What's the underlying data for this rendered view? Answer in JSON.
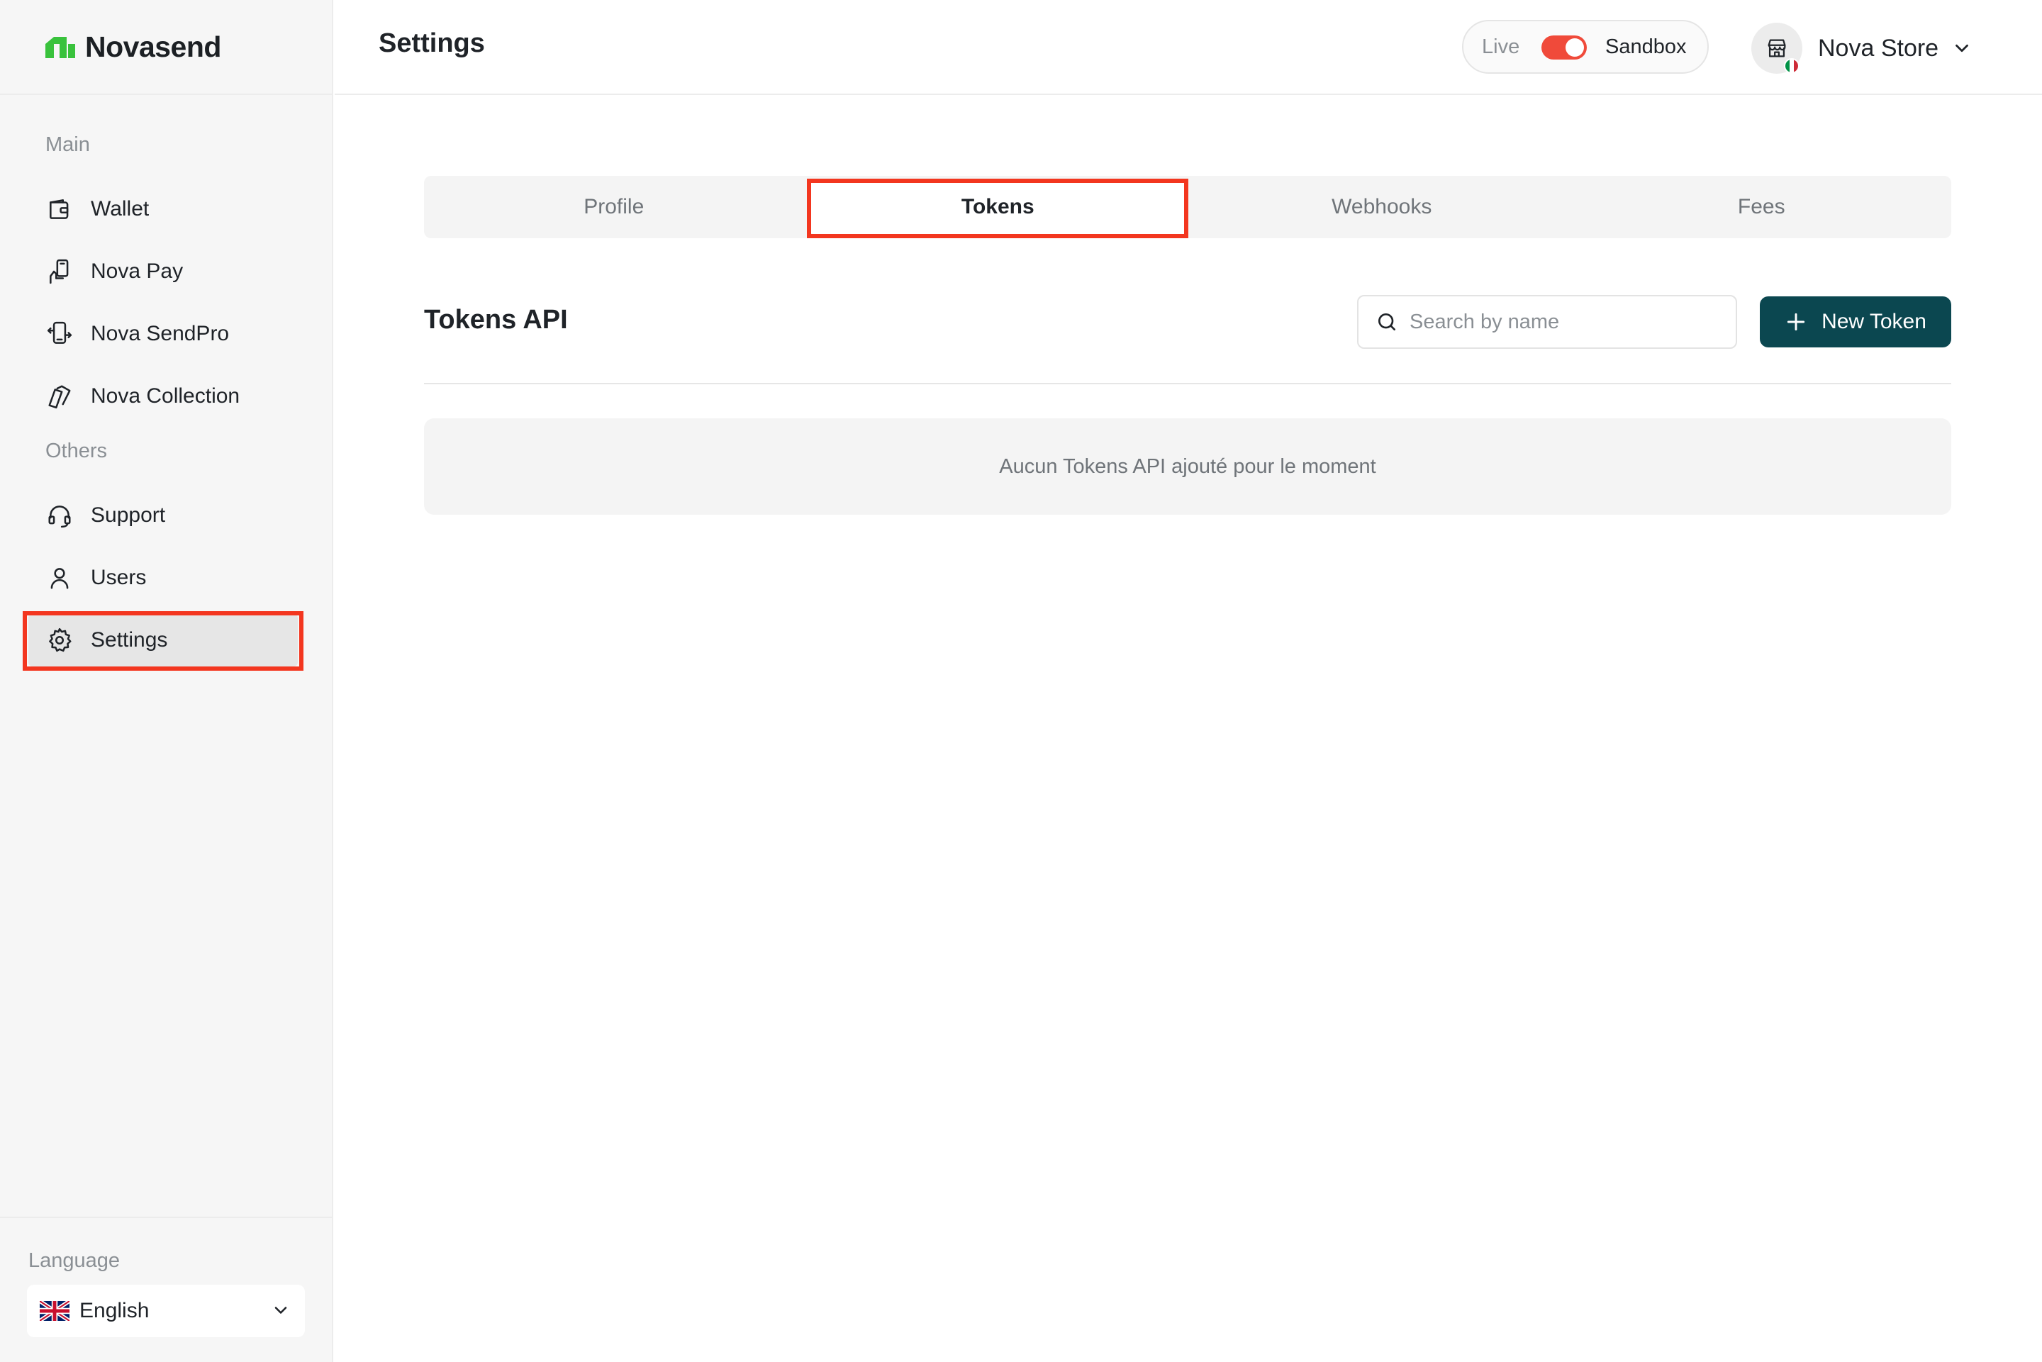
{
  "brand": {
    "name": "Novasend",
    "color": "#39c23c"
  },
  "sidebar": {
    "sections": {
      "main": "Main",
      "others": "Others"
    },
    "items": [
      {
        "label": "Wallet",
        "icon": "wallet-icon"
      },
      {
        "label": "Nova Pay",
        "icon": "hand-pay-icon"
      },
      {
        "label": "Nova SendPro",
        "icon": "transfer-icon"
      },
      {
        "label": "Nova Collection",
        "icon": "cards-icon"
      },
      {
        "label": "Support",
        "icon": "headset-icon"
      },
      {
        "label": "Users",
        "icon": "user-icon"
      },
      {
        "label": "Settings",
        "icon": "gear-icon",
        "active": true
      }
    ],
    "language": {
      "label": "Language",
      "selected": "English",
      "flag": "uk-flag-icon"
    }
  },
  "header": {
    "title": "Settings",
    "env": {
      "live_label": "Live",
      "sandbox_label": "Sandbox",
      "sandbox_active": true,
      "toggle_color": "#f04a3a"
    },
    "store": {
      "name": "Nova Store",
      "icon": "store-icon",
      "flag": "italy-flag-icon"
    }
  },
  "tabs": [
    {
      "label": "Profile"
    },
    {
      "label": "Tokens",
      "active": true
    },
    {
      "label": "Webhooks"
    },
    {
      "label": "Fees"
    }
  ],
  "tokens": {
    "title": "Tokens API",
    "search_placeholder": "Search by name",
    "new_button": "New Token",
    "button_color": "#0b4750",
    "empty_message": "Aucun Tokens API ajouté pour le moment"
  },
  "highlight_color": "#f3361f"
}
